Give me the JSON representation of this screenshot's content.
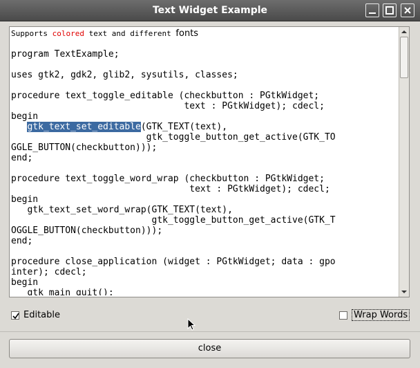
{
  "window": {
    "title": "Text Widget Example"
  },
  "text": {
    "intro": {
      "part1": "Supports ",
      "colored": "colored",
      "part2": " text and different ",
      "fonts": "fonts"
    },
    "lines": [
      "",
      "program TextExample;",
      "",
      "uses gtk2, gdk2, glib2, sysutils, classes;",
      "",
      "procedure text_toggle_editable (checkbutton : PGtkWidget;",
      "                                text : PGtkWidget); cdecl;",
      "begin"
    ],
    "selected_line": {
      "indent": "   ",
      "selection": "gtk_text_set_editable",
      "rest": "(GTK_TEXT(text),"
    },
    "lines2": [
      "                         gtk_toggle_button_get_active(GTK_TO",
      "GGLE_BUTTON(checkbutton)));",
      "end;",
      "",
      "procedure text_toggle_word_wrap (checkbutton : PGtkWidget;",
      "                                 text : PGtkWidget); cdecl;",
      "begin",
      "   gtk_text_set_word_wrap(GTK_TEXT(text),",
      "                          gtk_toggle_button_get_active(GTK_T",
      "OGGLE_BUTTON(checkbutton)));",
      "end;",
      "",
      "procedure close_application (widget : PGtkWidget; data : gpo",
      "inter); cdecl;",
      "begin",
      "   gtk_main_quit();"
    ]
  },
  "controls": {
    "editable_label": "Editable",
    "editable_checked": true,
    "wrap_label": "Wrap Words",
    "wrap_checked": false,
    "close_label": "close"
  }
}
